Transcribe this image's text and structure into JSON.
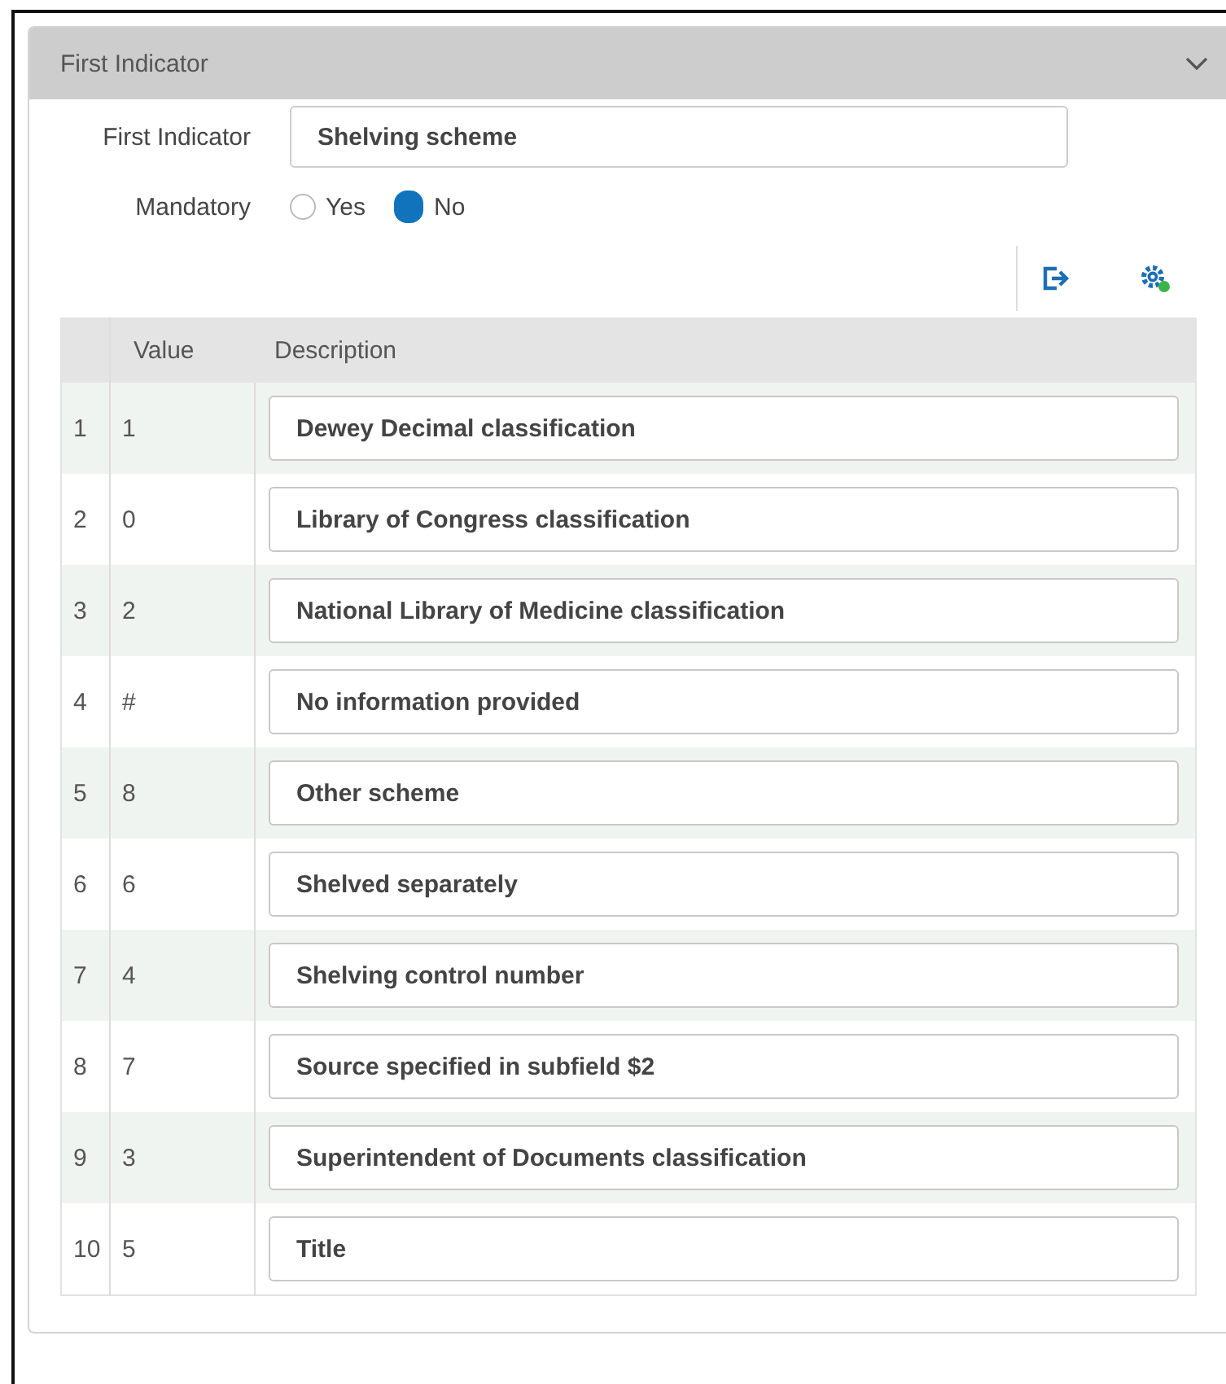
{
  "section": {
    "title": "First Indicator",
    "expanded": true
  },
  "form": {
    "label": "First Indicator",
    "value": "Shelving scheme"
  },
  "mandatory": {
    "label": "Mandatory",
    "options": [
      {
        "label": "Yes",
        "selected": false
      },
      {
        "label": "No",
        "selected": true
      }
    ]
  },
  "table": {
    "columns": [
      "Value",
      "Description"
    ],
    "rows": [
      {
        "index": "1",
        "value": "1",
        "description": "Dewey Decimal classification"
      },
      {
        "index": "2",
        "value": "0",
        "description": "Library of Congress classification"
      },
      {
        "index": "3",
        "value": "2",
        "description": "National Library of Medicine classification"
      },
      {
        "index": "4",
        "value": "#",
        "description": "No information provided"
      },
      {
        "index": "5",
        "value": "8",
        "description": "Other scheme"
      },
      {
        "index": "6",
        "value": "6",
        "description": "Shelved separately"
      },
      {
        "index": "7",
        "value": "4",
        "description": "Shelving control number"
      },
      {
        "index": "8",
        "value": "7",
        "description": "Source specified in subfield $2"
      },
      {
        "index": "9",
        "value": "3",
        "description": "Superintendent of Documents classification"
      },
      {
        "index": "10",
        "value": "5",
        "description": "Title"
      }
    ]
  }
}
